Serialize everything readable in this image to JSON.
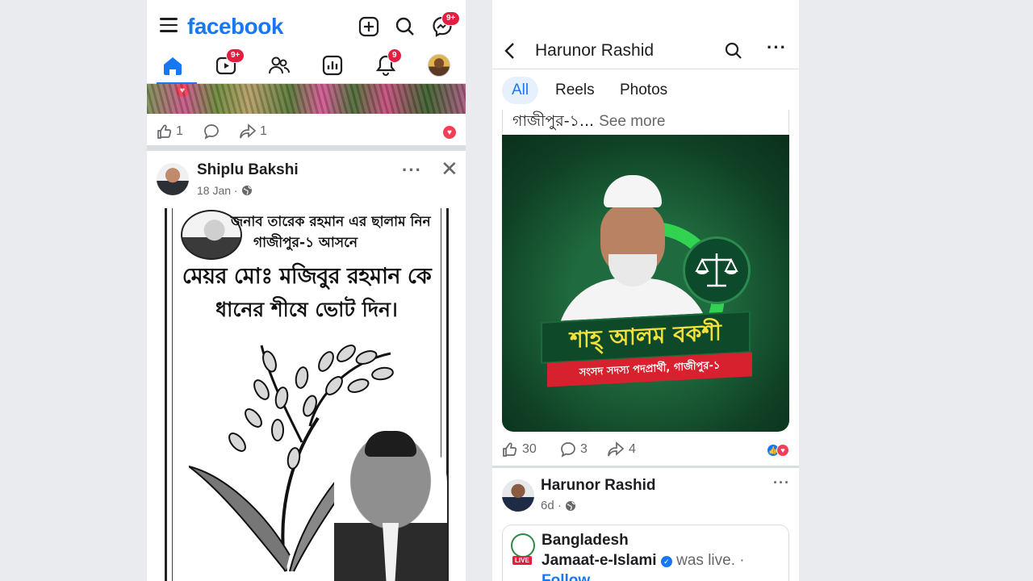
{
  "left": {
    "logo": "facebook",
    "badges": {
      "messenger": "9+",
      "video": "9+",
      "notifications": "9"
    },
    "post1": {
      "like_count": "1",
      "share_count": "1"
    },
    "post2": {
      "author": "Shiplu Bakshi",
      "date": "18 Jan ·",
      "poster": {
        "line1": "জনাব তারেক রহমান এর ছালাম নিন",
        "line2": "গাজীপুর-১ আসনে",
        "line3": "মেয়র মোঃ মজিবুর রহমান কে",
        "line4": "ধানের শীষে ভোট দিন।"
      }
    }
  },
  "right": {
    "title": "Harunor Rashid",
    "tabs": [
      "All",
      "Reels",
      "Photos"
    ],
    "post1": {
      "caption": "গাজীপুর-১...",
      "see_more": "See more",
      "banner_name": "শাহ্ আলম বকশী",
      "banner_sub": "সংসদ সদস্য পদপ্রার্থী, গাজীপুর-১",
      "likes": "30",
      "comments": "3",
      "shares": "4"
    },
    "post2": {
      "author": "Harunor Rashid",
      "time": "6d ·",
      "shared_page_line1": "Bangladesh",
      "shared_page_line2": "Jamaat-e-Islami",
      "was_live": "was live. ·",
      "follow": "Follow",
      "live_tag": "LIVE"
    }
  },
  "colors": {
    "brand": "#1877f2",
    "badge": "#e41e3f",
    "campaign_green": "#0f3f24"
  }
}
